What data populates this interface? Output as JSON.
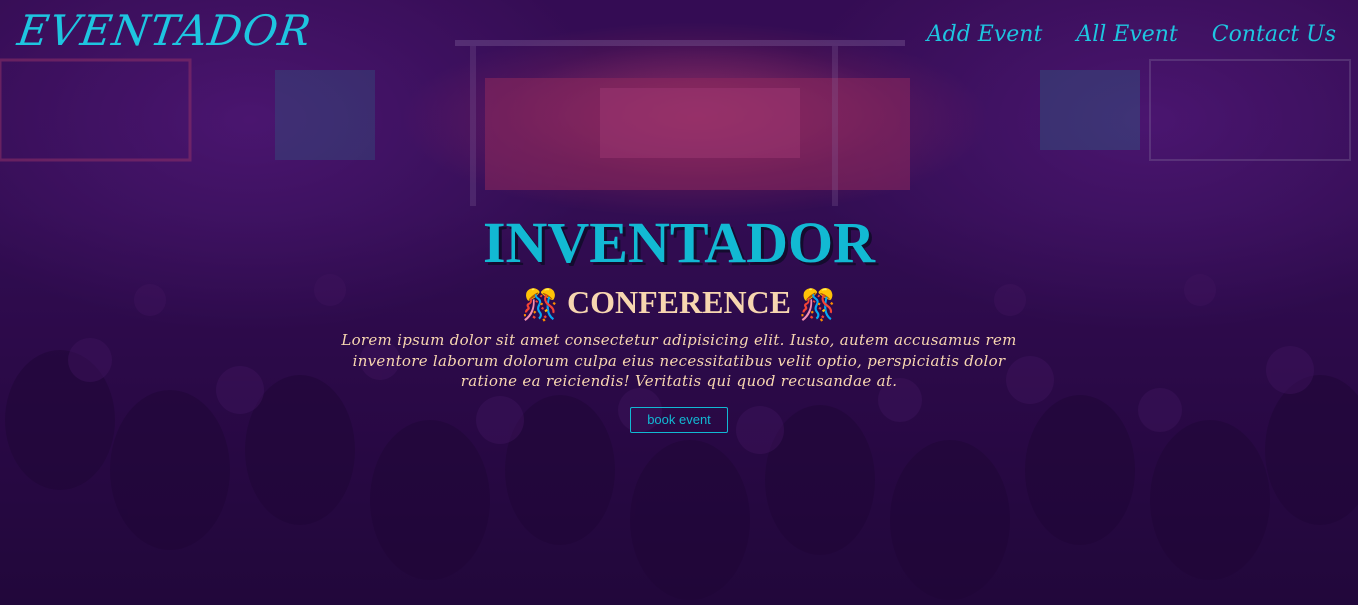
{
  "nav": {
    "logo": "EVENTADOR",
    "links": [
      {
        "label": "Add Event"
      },
      {
        "label": "All Event"
      },
      {
        "label": "Contact Us"
      }
    ]
  },
  "hero": {
    "title": "INVENTADOR",
    "subtitle_icon": "🎊",
    "subtitle": "CONFERENCE",
    "description": "Lorem ipsum dolor sit amet consectetur adipisicing elit. Iusto, autem accusamus rem inventore laborum dolorum culpa eius necessitatibus velit optio, perspiciatis dolor ratione ea reiciendis! Veritatis qui quod recusandae at.",
    "button_label": "book event",
    "background_image": "concert-crowd-stage-photo"
  },
  "colors": {
    "accent": "#12b9d3",
    "text_light": "#f7d6b0",
    "overlay": "#2a0a45"
  }
}
